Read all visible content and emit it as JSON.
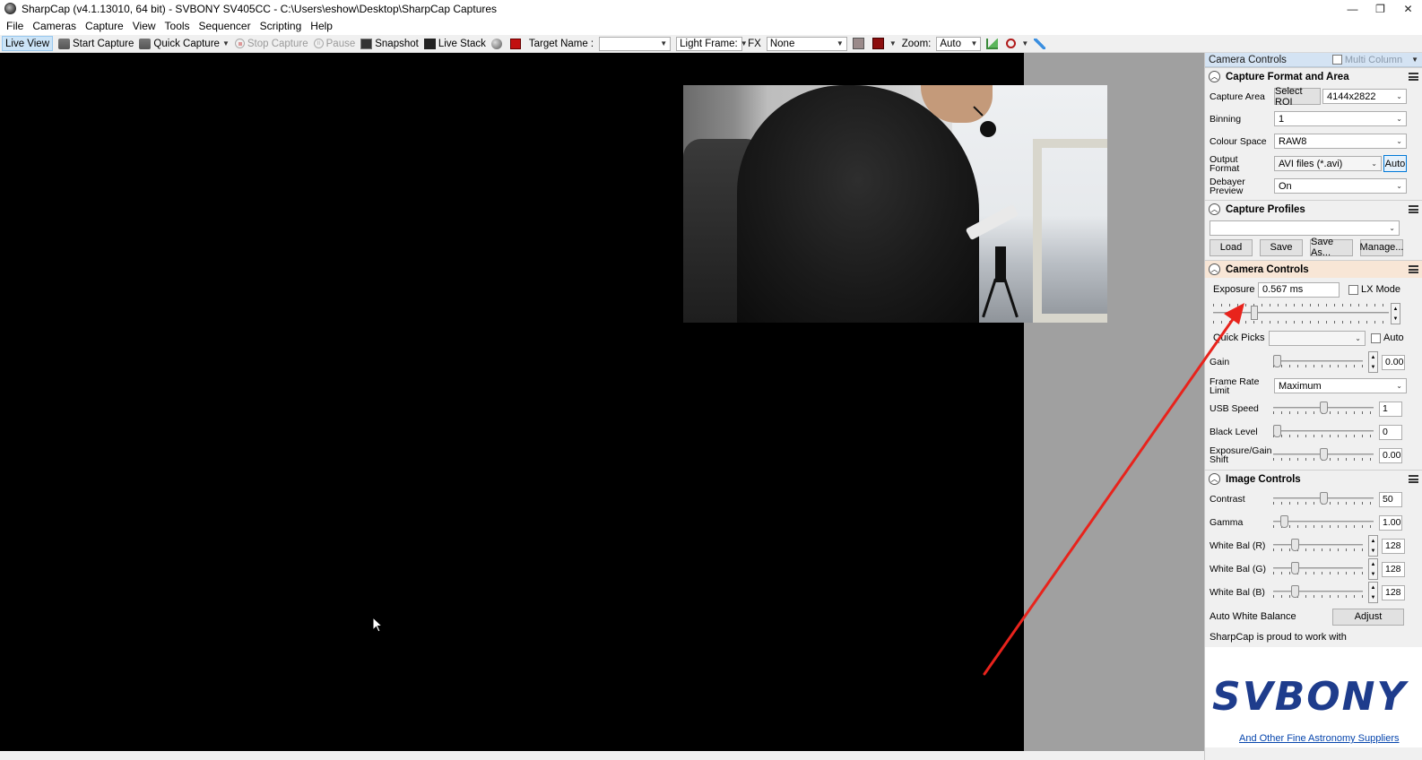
{
  "window": {
    "title": "SharpCap (v4.1.13010, 64 bit) - SVBONY SV405CC - C:\\Users\\eshow\\Desktop\\SharpCap Captures",
    "controls": {
      "minimize": "—",
      "restore": "❐",
      "close": "✕"
    }
  },
  "menu": [
    "File",
    "Cameras",
    "Capture",
    "View",
    "Tools",
    "Sequencer",
    "Scripting",
    "Help"
  ],
  "toolbar": {
    "live_view": "Live View",
    "start_capture": "Start Capture",
    "quick_capture": "Quick Capture",
    "stop_capture": "Stop Capture",
    "pause": "Pause",
    "snapshot": "Snapshot",
    "live_stack": "Live Stack",
    "target_name_label": "Target Name :",
    "target_name_value": "",
    "frame_type": "Light Frame:",
    "fx_label": "FX",
    "fx_value": "None",
    "zoom_label": "Zoom:",
    "zoom_value": "Auto"
  },
  "panel": {
    "title": "Camera Controls",
    "multi_column": "Multi Column",
    "capture_format": {
      "title": "Capture Format and Area",
      "capture_area_label": "Capture Area",
      "select_roi": "Select ROI",
      "capture_area_value": "4144x2822",
      "binning_label": "Binning",
      "binning_value": "1",
      "colour_space_label": "Colour Space",
      "colour_space_value": "RAW8",
      "output_format_label": "Output Format",
      "output_format_value": "AVI files (*.avi)",
      "auto_button": "Auto",
      "debayer_label": "Debayer Preview",
      "debayer_value": "On"
    },
    "capture_profiles": {
      "title": "Capture Profiles",
      "profile_value": "",
      "load": "Load",
      "save": "Save",
      "save_as": "Save As...",
      "manage": "Manage..."
    },
    "camera_controls": {
      "title": "Camera Controls",
      "exposure_label": "Exposure",
      "exposure_value": "0.567 ms",
      "lx_mode": "LX Mode",
      "quick_picks_label": "Quick Picks",
      "auto_label": "Auto",
      "gain_label": "Gain",
      "gain_value": "0.00",
      "frame_rate_label": "Frame Rate Limit",
      "frame_rate_value": "Maximum",
      "usb_speed_label": "USB Speed",
      "usb_speed_value": "1",
      "black_level_label": "Black Level",
      "black_level_value": "0",
      "exposure_gain_shift_label": "Exposure/Gain Shift",
      "exposure_gain_shift_value": "0.00"
    },
    "image_controls": {
      "title": "Image Controls",
      "contrast_label": "Contrast",
      "contrast_value": "50",
      "gamma_label": "Gamma",
      "gamma_value": "1.00",
      "wb_r_label": "White Bal (R)",
      "wb_r_value": "128",
      "wb_g_label": "White Bal (G)",
      "wb_g_value": "128",
      "wb_b_label": "White Bal (B)",
      "wb_b_value": "128",
      "auto_wb_label": "Auto White Balance",
      "adjust": "Adjust"
    },
    "sponsor": {
      "text": "SharpCap is proud to work with",
      "logo": "SVBONY",
      "link": "And Other Fine Astronomy Suppliers"
    }
  },
  "icons": [
    "app-icon",
    "camera-icon",
    "stop-icon",
    "pause-icon",
    "snapshot-icon",
    "live-stack-icon",
    "histogram-icon",
    "zoom-icon",
    "mouse-cursor-icon"
  ],
  "colors": {
    "accent_selection": "#cce4f7",
    "panel_header": "#d4e3f3",
    "annotation_arrow": "#e8231c",
    "svbony_blue": "#1e3c8c",
    "svbony_orange": "#e8552d"
  }
}
